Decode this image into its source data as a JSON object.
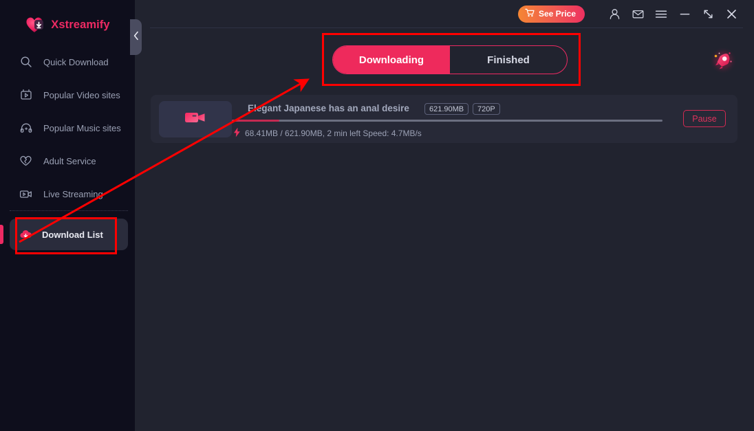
{
  "app": {
    "brand_name": "Xstreamify",
    "logo_icon": "heart-download-icon"
  },
  "sidebar": {
    "collapse_icon": "chevron-left-icon",
    "items": [
      {
        "label": "Quick Download",
        "icon": "search-icon"
      },
      {
        "label": "Popular Video sites",
        "icon": "video-box-icon"
      },
      {
        "label": "Popular Music sites",
        "icon": "headphones-icon"
      },
      {
        "label": "Adult Service",
        "icon": "broken-heart-icon"
      },
      {
        "label": "Live Streaming",
        "icon": "live-video-icon"
      }
    ],
    "active_item": {
      "label": "Download List",
      "icon": "cloud-download-icon"
    }
  },
  "header": {
    "see_price_label": "See Price",
    "see_price_icon": "shopping-cart-icon",
    "icons": [
      {
        "name": "account-icon"
      },
      {
        "name": "mail-icon"
      },
      {
        "name": "menu-icon"
      },
      {
        "name": "minimize-icon"
      },
      {
        "name": "restore-icon"
      },
      {
        "name": "close-icon"
      }
    ]
  },
  "main": {
    "tabs": [
      {
        "label": "Downloading",
        "active": true
      },
      {
        "label": "Finished",
        "active": false
      }
    ],
    "rocket_icon": "rocket-icon",
    "download_item": {
      "thumbnail_icon": "video-camera-icon",
      "title": "Elegant Japanese has an anal desire",
      "size_badge": "621.90MB",
      "quality_badge": "720P",
      "progress_percent": 11,
      "status_icon": "lightning-bolt-icon",
      "status_text": "68.41MB / 621.90MB, 2 min left Speed: 4.7MB/s",
      "action_label": "Pause"
    }
  },
  "colors": {
    "accent_pink": "#ee2a63",
    "tab_active_bg": "#ee2a5c",
    "sidebar_bg": "#0e0e1c",
    "main_bg": "#21232f",
    "card_bg": "#272937",
    "annotation_red": "#ff0000"
  }
}
